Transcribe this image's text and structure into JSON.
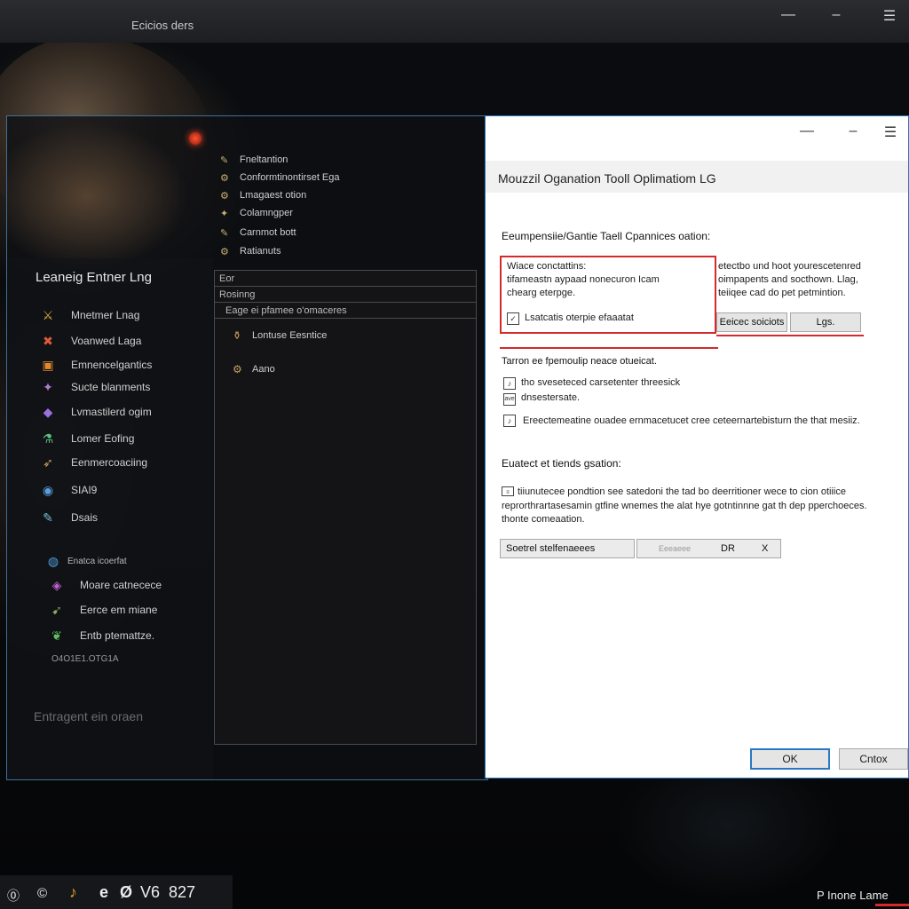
{
  "app": {
    "title": "Ecicios ders",
    "window_controls": {
      "minimize": "—",
      "maximize": "–",
      "close": "☰"
    }
  },
  "launcher": {
    "sidebar_title": "Leaneig Entner Lng",
    "sidebar_items": [
      {
        "label": "Mnetmer Lnag",
        "icon": "sword-icon",
        "glyph": "⚔"
      },
      {
        "label": "Voanwed Laga",
        "icon": "crossed-swords-icon",
        "glyph": "✖"
      },
      {
        "label": "Emnencelgantics",
        "icon": "chest-icon",
        "glyph": "▣"
      },
      {
        "label": "Sucte blanments",
        "icon": "gear-wand-icon",
        "glyph": "✦"
      },
      {
        "label": "Lvmastilerd ogim",
        "icon": "crystal-icon",
        "glyph": "◆"
      },
      {
        "label": "Lomer Eofing",
        "icon": "potion-icon",
        "glyph": "⚗"
      },
      {
        "label": "Eenmercoaciing",
        "icon": "wing-icon",
        "glyph": "➶"
      },
      {
        "label": "SIAI9",
        "icon": "globe-icon",
        "glyph": "◉"
      },
      {
        "label": "Dsais",
        "icon": "feather-icon",
        "glyph": "✎"
      },
      {
        "label": "Enatca icoerfat",
        "icon": "shield-icon",
        "glyph": "◍"
      },
      {
        "label": "Moare catnecece",
        "icon": "gem-icon",
        "glyph": "◈"
      },
      {
        "label": "Eerce em miane",
        "icon": "arrow-icon",
        "glyph": "➹"
      },
      {
        "label": "Entb ptemattze.",
        "icon": "leaf-icon",
        "glyph": "❦"
      },
      {
        "label": "O4O1E1.OTG1A",
        "icon": "dots-icon",
        "glyph": ""
      }
    ],
    "sidebar_bottom": "Entragent ein oraen",
    "menu": [
      {
        "label": "Fneltantion",
        "glyph": "✎"
      },
      {
        "label": "Conformtinontirset Ega",
        "glyph": "⚙"
      },
      {
        "label": "Lmagaest otion",
        "glyph": "⚙"
      },
      {
        "label": "Colamngper",
        "glyph": "✦"
      },
      {
        "label": "Carnmot bott",
        "glyph": "✎"
      },
      {
        "label": "Ratianuts",
        "glyph": "⚙"
      }
    ],
    "panel": {
      "row1": "Eor",
      "row2": "Rosinng",
      "row3": "Eage ei pfamee o'omaceres",
      "entries": [
        {
          "label": "Lontuse Eesntice",
          "glyph": "⚱"
        },
        {
          "label": "Aano",
          "glyph": "⚙"
        }
      ]
    }
  },
  "dialog": {
    "title": "Mouzzil Oganation Tooll Oplimatiom LG",
    "window_controls": {
      "minimize": "—",
      "maximize": "–",
      "close": "☰"
    },
    "section1_heading": "Eeumpensiie/Gantie Taell Cpannices oation:",
    "box_lines": [
      "Wiace conctattins:",
      "tifameastn aypaad nonecuron Icam",
      "chearg eterpge."
    ],
    "box_check_label": "Lsatcatis oterpie efaaatat",
    "right_text": [
      "etectbo und hoot yourescetenred",
      "oimpapents and socthown. Llag,",
      "teiiqee cad do pet petmintion."
    ],
    "btn_select": "Eeicec soiciots",
    "btn_lg": "Lgs.",
    "section2_heading": "Tarron ee fpemoulip neace otueicat.",
    "checks": [
      {
        "label": "tho sveseteced carsetenter threesick",
        "glyph": "♪"
      },
      {
        "label": "dnsestersate.",
        "glyph": "ave"
      },
      {
        "label": "Ereectemeatine ouadee ernmacetucet cree ceteernartebisturn the that mesiiz.",
        "glyph": "♪"
      }
    ],
    "section3_heading": "Euatect et tiends gsation:",
    "para_lines": [
      "tiiunutecee pondtion see satedoni the tad bo deerritioner wece to cion otiiice",
      "reprorthrartasesamin gtfine wnemes the alat hye gotntinnne gat th dep pperchoeces.",
      "thonte comeaation."
    ],
    "field_label": "Soetrel stelfenaeees",
    "field_mid_faint": "Eeeaeee",
    "field_mid": "DR",
    "field_close": "X",
    "ok_button": "OK",
    "cancel_button": "Cntox"
  },
  "taskbar": {
    "items": [
      "⓪",
      "©",
      "♪",
      "e",
      "Ø",
      "V6",
      "827"
    ],
    "tray_text": "P Inone Lame",
    "tray_accent": "#d42a2a"
  }
}
